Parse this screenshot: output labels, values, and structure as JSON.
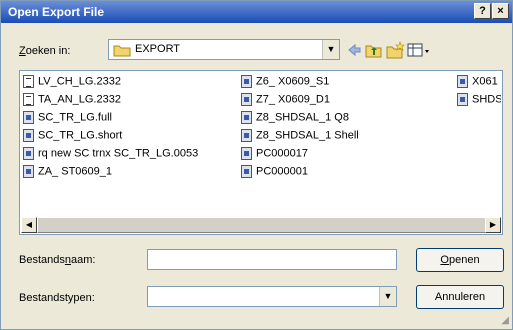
{
  "window": {
    "title": "Open Export File",
    "help_label": "?",
    "close_label": "×"
  },
  "lookin": {
    "label_pre": "Z",
    "label_post": "oeken in:",
    "folder": "EXPORT"
  },
  "toolbar": {
    "icons": [
      "back-icon",
      "up-folder-icon",
      "new-folder-icon",
      "view-menu-icon"
    ]
  },
  "files": {
    "col1": [
      {
        "name": "LV_CH_LG.2332",
        "icon": "text-file-icon"
      },
      {
        "name": "TA_AN_LG.2332",
        "icon": "text-file-icon"
      },
      {
        "name": "SC_TR_LG.full",
        "icon": "binary-file-icon"
      },
      {
        "name": "SC_TR_LG.short",
        "icon": "binary-file-icon"
      },
      {
        "name": "rq new SC trnx SC_TR_LG.0053",
        "icon": "binary-file-icon"
      },
      {
        "name": "ZA_ ST0609_1",
        "icon": "binary-file-icon"
      }
    ],
    "col2": [
      {
        "name": "Z6_ X0609_S1",
        "icon": "binary-file-icon"
      },
      {
        "name": "Z7_ X0609_D1",
        "icon": "binary-file-icon"
      },
      {
        "name": "Z8_SHDSAL_1 Q8",
        "icon": "binary-file-icon"
      },
      {
        "name": "Z8_SHDSAL_1 Shell",
        "icon": "binary-file-icon"
      },
      {
        "name": "PC000017",
        "icon": "binary-file-icon"
      },
      {
        "name": "PC000001",
        "icon": "binary-file-icon"
      }
    ],
    "col3": [
      {
        "name": "X061",
        "icon": "binary-file-icon"
      },
      {
        "name": "SHDS",
        "icon": "binary-file-icon"
      }
    ]
  },
  "filename": {
    "label_pre": "Bestands",
    "label_u": "n",
    "label_post": "aam:",
    "value": ""
  },
  "filetype": {
    "label": "Bestandstypen:",
    "value": ""
  },
  "buttons": {
    "open_u": "O",
    "open_rest": "penen",
    "cancel": "Annuleren"
  }
}
